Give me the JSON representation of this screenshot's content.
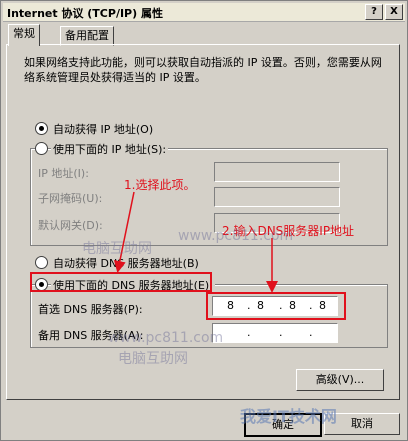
{
  "window": {
    "title": "Internet 协议 (TCP/IP) 属性",
    "help_button": "?",
    "close_button": "X"
  },
  "tabs": [
    {
      "label": "常规",
      "active": true
    },
    {
      "label": "备用配置",
      "active": false
    }
  ],
  "intro_text": "如果网络支持此功能，则可以获取自动指派的 IP 设置。否则，您需要从网络系统管理员处获得适当的 IP 设置。",
  "ip_section": {
    "auto_label": "自动获得 IP 地址(O)",
    "manual_label": "使用下面的 IP 地址(S):",
    "selected": "auto",
    "fields": [
      {
        "label": "IP 地址(I):",
        "value": ""
      },
      {
        "label": "子网掩码(U):",
        "value": ""
      },
      {
        "label": "默认网关(D):",
        "value": ""
      }
    ]
  },
  "dns_section": {
    "auto_label": "自动获得 DNS 服务器地址(B)",
    "manual_label": "使用下面的 DNS 服务器地址(E):",
    "selected": "manual",
    "preferred_label": "首选 DNS 服务器(P):",
    "preferred_octets": [
      "8",
      "8",
      "8",
      "8"
    ],
    "alternate_label": "备用 DNS 服务器(A):",
    "alternate_octets": [
      "",
      "",
      "",
      ""
    ]
  },
  "buttons": {
    "advanced": "高级(V)...",
    "ok": "确定",
    "cancel": "取消"
  },
  "annotations": {
    "step1": "1.选择此项。",
    "step2": "2.输入DNS服务器IP地址"
  },
  "watermarks": {
    "site": "www.pc811.com",
    "name": "电脑互助网",
    "brand": "我爱IT技术网"
  },
  "colors": {
    "annotation_red": "#e0101c",
    "dialog_face": "#d4d0c8"
  }
}
